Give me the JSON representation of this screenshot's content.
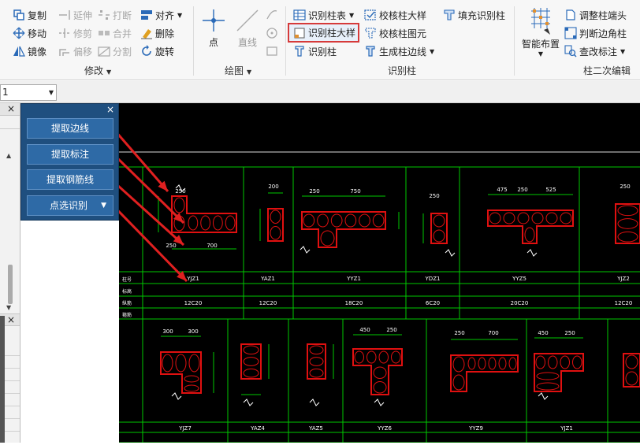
{
  "ribbon": {
    "modify": {
      "group_label": "修改",
      "copy": "复制",
      "extend": "延伸",
      "break": "打断",
      "align": "对齐",
      "move": "移动",
      "trim": "修剪",
      "merge": "合并",
      "delete": "删除",
      "mirror": "镜像",
      "offset": "偏移",
      "split": "分割",
      "rotate": "旋转"
    },
    "draw": {
      "group_label": "绘图",
      "point": "点",
      "line": "直线"
    },
    "recognize": {
      "group_label": "识别柱",
      "column_table": "识别柱表",
      "check_detail": "校核柱大样",
      "fill_recognize": "填充识别柱",
      "column_detail": "识别柱大样",
      "check_element": "校核柱图元",
      "column": "识别柱",
      "gen_edge": "生成柱边线"
    },
    "secondary": {
      "group_label": "柱二次编辑",
      "smart_layout": "智能布置",
      "adjust_end": "调整柱端头",
      "judge_corner": "判断边角柱",
      "view_mark": "查改标注"
    }
  },
  "toolbar2": {
    "combo_value": "1"
  },
  "popup": {
    "close": "×",
    "extract_edge": "提取边线",
    "extract_mark": "提取标注",
    "extract_rebar": "提取钢筋线",
    "point_recognize": "点选识别",
    "dropdown": "▼"
  },
  "leftpane": {
    "close1": "×",
    "close2": "×"
  },
  "cad": {
    "row1_headers": [
      "柱号",
      "标高",
      "纵筋",
      "箍筋"
    ],
    "row1_names": [
      "YJZ1",
      "YAZ1",
      "YYZ1",
      "YDZ1",
      "YYZ5",
      "YJZ2"
    ],
    "row1_rebar": [
      "12C20",
      "12C20",
      "18C20",
      "6C20",
      "20C20",
      "12C20"
    ],
    "row2_names": [
      "YJZ7",
      "YAZ4",
      "YAZ5",
      "YYZ6",
      "YYZ9",
      "YJZ1"
    ],
    "dims_top": [
      "250",
      "200",
      "250",
      "750",
      "250",
      "475",
      "250",
      "525",
      "250"
    ],
    "dims_bottom": [
      "250",
      "700",
      "300",
      "300",
      "450",
      "250",
      "250",
      "700",
      "450",
      "250"
    ]
  },
  "colors": {
    "ribbon_bg": "#f7f7f7",
    "popup_bg": "#1f4f7f",
    "popup_btn": "#2e6aa6",
    "cad_bg": "#000000",
    "cad_green": "#00c800",
    "cad_red": "#e01010",
    "highlight_border": "#d63a3a",
    "arrow": "#e02020"
  }
}
